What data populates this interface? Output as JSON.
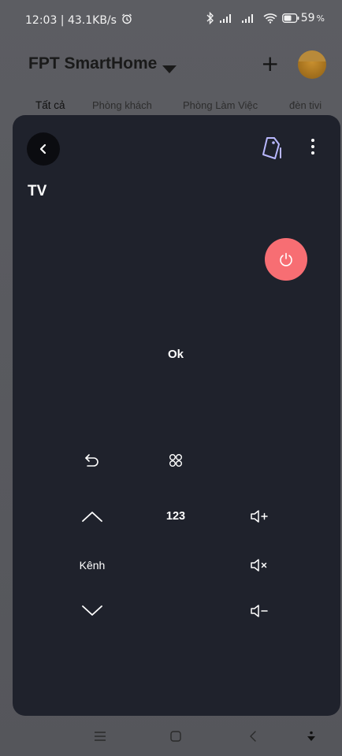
{
  "status_bar": {
    "time_speed": "12:03 | 43.1KB/s",
    "battery": "59",
    "battery_unit": "%"
  },
  "header": {
    "title": "FPT SmartHome"
  },
  "tabs": [
    {
      "label": "Tất cả",
      "active": true
    },
    {
      "label": "Phòng khách",
      "active": false
    },
    {
      "label": "Phòng Làm Việc",
      "active": false
    },
    {
      "label": "đèn tivi",
      "active": false
    }
  ],
  "remote": {
    "device_name": "TV",
    "ok_label": "Ok",
    "number_label": "123",
    "channel_label": "Kênh"
  },
  "icons": {
    "power": "power-icon",
    "back": "chevron-left-icon",
    "tag": "tag-icon",
    "more": "more-vertical-icon",
    "return": "return-icon",
    "apps": "apps-grid-icon",
    "channel_up": "chevron-up-icon",
    "channel_down": "chevron-down-icon",
    "volume_up": "volume-up-icon",
    "mute": "volume-mute-icon",
    "volume_down": "volume-down-icon"
  },
  "colors": {
    "panel_bg": "#1f222c",
    "power_button": "#f76e73",
    "tag_icon": "#b9b8ff",
    "overlay": "#5c5d62"
  }
}
